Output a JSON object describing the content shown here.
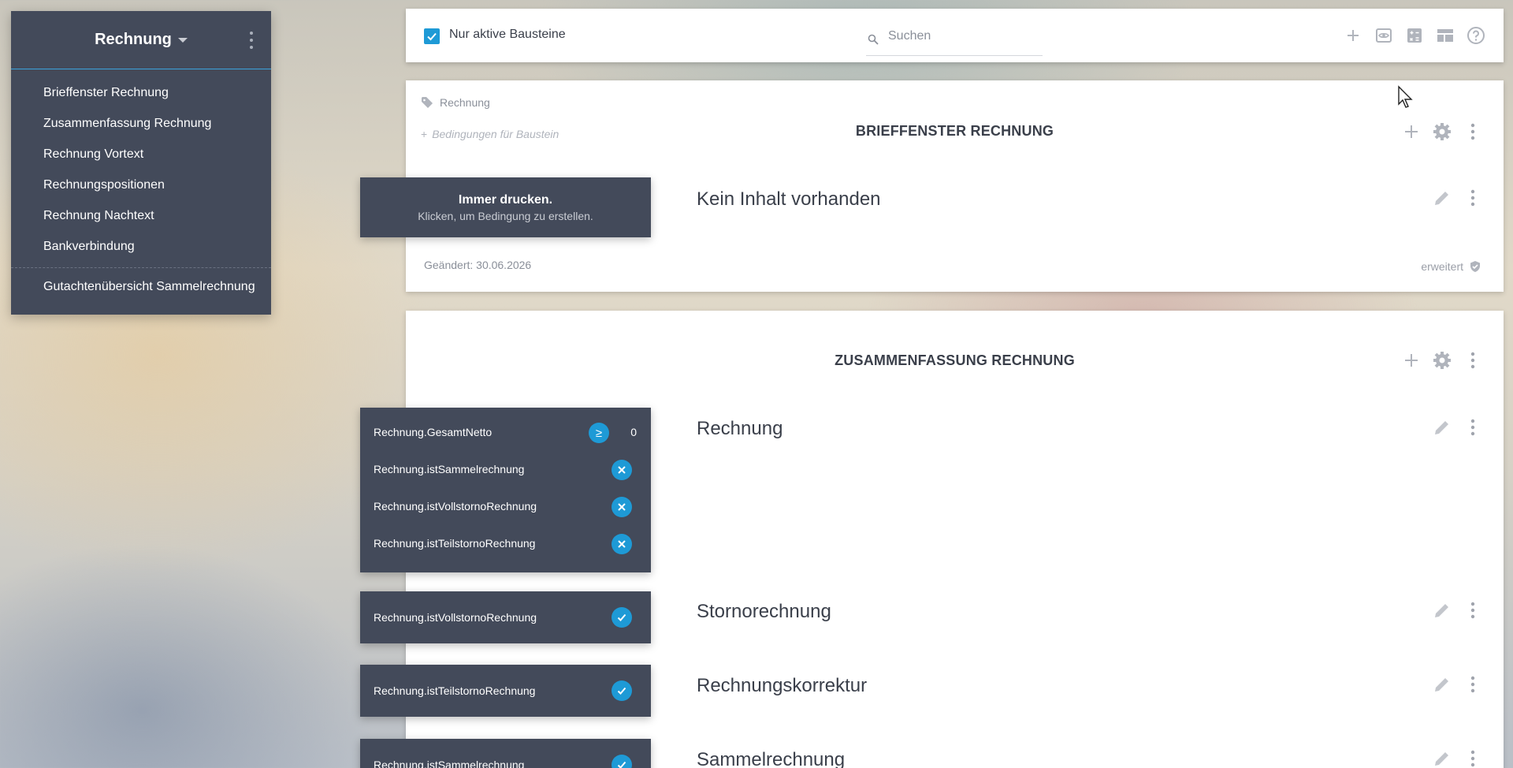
{
  "sidebar": {
    "title": "Rechnung",
    "items": [
      {
        "label": "Brieffenster Rechnung"
      },
      {
        "label": "Zusammenfassung Rechnung"
      },
      {
        "label": "Rechnung Vortext"
      },
      {
        "label": "Rechnungspositionen"
      },
      {
        "label": "Rechnung Nachtext"
      },
      {
        "label": "Bankverbindung"
      }
    ],
    "extra_item": {
      "label": "Gutachtenübersicht Sammelrechnung"
    }
  },
  "toolbar": {
    "checkbox_label": "Nur aktive Bausteine",
    "search_placeholder": "Suchen"
  },
  "card1": {
    "tag": "Rechnung",
    "conditions_hint": "Bedingungen für Baustein",
    "title": "BRIEFFENSTER RECHNUNG",
    "content_title": "Kein Inhalt vorhanden",
    "modified": "Geändert: 30.06.2026",
    "extended": "erweitert"
  },
  "card2": {
    "title": "ZUSAMMENFASSUNG RECHNUNG",
    "rows": [
      {
        "title": "Rechnung"
      },
      {
        "title": "Stornorechnung"
      },
      {
        "title": "Rechnungskorrektur"
      },
      {
        "title": "Sammelrechnung"
      }
    ]
  },
  "conditions": {
    "always": {
      "line1": "Immer drucken.",
      "line2": "Klicken, um Bedingung zu erstellen."
    },
    "group1": [
      {
        "label": "Rechnung.GesamtNetto",
        "operator": "≥",
        "value": "0"
      },
      {
        "label": "Rechnung.istSammelrechnung"
      },
      {
        "label": "Rechnung.istVollstornoRechnung"
      },
      {
        "label": "Rechnung.istTeilstornoRechnung"
      }
    ],
    "single1": {
      "label": "Rechnung.istVollstornoRechnung"
    },
    "single2": {
      "label": "Rechnung.istTeilstornoRechnung"
    },
    "single3": {
      "label": "Rechnung.istSammelrechnung"
    }
  },
  "colors": {
    "accent": "#1e9ad6",
    "dark_panel": "#434a5a"
  }
}
